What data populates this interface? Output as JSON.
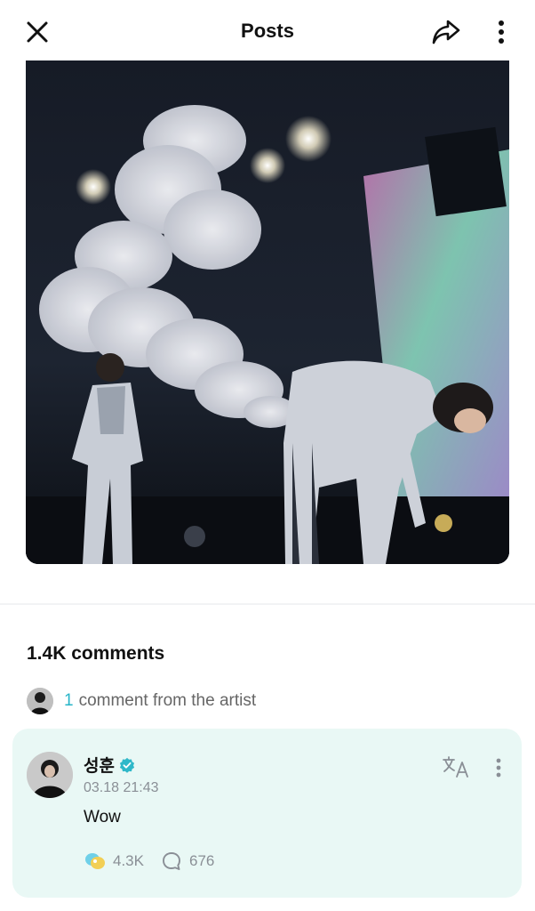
{
  "header": {
    "title": "Posts",
    "close_icon": "close-icon",
    "share_icon": "share-icon",
    "more_icon": "more-vertical-icon"
  },
  "post": {
    "image_subject": "photo"
  },
  "comments": {
    "count_label": "1.4K comments",
    "artist_summary": {
      "count": "1",
      "label": "comment from the artist"
    },
    "featured": {
      "author": "성훈",
      "verified_icon": "verified-badge-icon",
      "timestamp": "03.18 21:43",
      "text": "Wow",
      "likes": "4.3K",
      "replies": "676",
      "translate_icon": "translate-icon",
      "more_icon": "more-vertical-icon"
    }
  },
  "colors": {
    "accent": "#28b5c8",
    "card_bg": "#e9f8f5",
    "muted_text": "#8a8f96",
    "verified": "#2fb8c9"
  }
}
